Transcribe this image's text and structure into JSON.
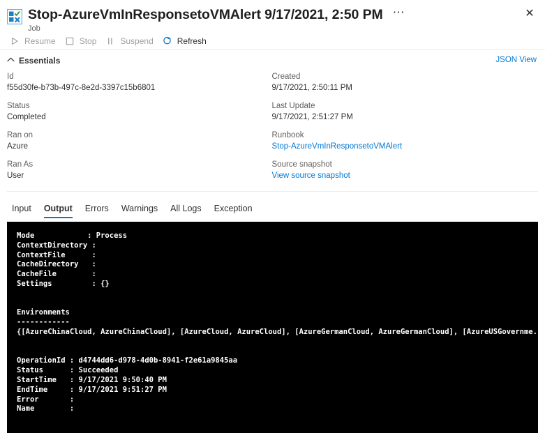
{
  "header": {
    "icon": "automation-job-icon",
    "title": "Stop-AzureVmInResponsetoVMAlert 9/17/2021, 2:50 PM",
    "subtitle": "Job",
    "more_label": "⋯",
    "close_label": "✕"
  },
  "commandbar": {
    "items": [
      {
        "label": "Resume",
        "icon": "play-icon",
        "enabled": false
      },
      {
        "label": "Stop",
        "icon": "stop-square-icon",
        "enabled": false
      },
      {
        "label": "Suspend",
        "icon": "pause-icon",
        "enabled": false
      },
      {
        "label": "Refresh",
        "icon": "refresh-icon",
        "enabled": true
      }
    ]
  },
  "essentials": {
    "heading": "Essentials",
    "collapse_icon": "chevron-up-icon",
    "json_view_label": "JSON View",
    "left": [
      {
        "label": "Id",
        "value": "f55d30fe-b73b-497c-8e2d-3397c15b6801",
        "link": false
      },
      {
        "label": "Status",
        "value": "Completed",
        "link": false
      },
      {
        "label": "Ran on",
        "value": "Azure",
        "link": false
      },
      {
        "label": "Ran As",
        "value": "User",
        "link": false
      }
    ],
    "right": [
      {
        "label": "Created",
        "value": "9/17/2021, 2:50:11 PM",
        "link": false
      },
      {
        "label": "Last Update",
        "value": "9/17/2021, 2:51:27 PM",
        "link": false
      },
      {
        "label": "Runbook",
        "value": "Stop-AzureVmInResponsetoVMAlert",
        "link": true
      },
      {
        "label": "Source snapshot",
        "value": "View source snapshot",
        "link": true
      }
    ]
  },
  "tabs": {
    "items": [
      {
        "label": "Input",
        "active": false
      },
      {
        "label": "Output",
        "active": true
      },
      {
        "label": "Errors",
        "active": false
      },
      {
        "label": "Warnings",
        "active": false
      },
      {
        "label": "All Logs",
        "active": false
      },
      {
        "label": "Exception",
        "active": false
      }
    ]
  },
  "console": {
    "text": "Mode            : Process\nContextDirectory :\nContextFile      :\nCacheDirectory   :\nCacheFile        :\nSettings         : {}\n\n\nEnvironments\n------------\n{[AzureChinaCloud, AzureChinaCloud], [AzureCloud, AzureCloud], [AzureGermanCloud, AzureGermanCloud], [AzureUSGovernme...\n\n\nOperationId : d4744dd6-d978-4d0b-8941-f2e61a9845aa\nStatus      : Succeeded\nStartTime   : 9/17/2021 9:50:40 PM\nEndTime     : 9/17/2021 9:51:27 PM\nError       :\nName        :"
  },
  "colors": {
    "accent": "#0078d4",
    "link": "#0078d4",
    "console_bg": "#000000",
    "console_fg": "#ffffff",
    "label": "#605e5c",
    "disabled": "#a19f9d"
  }
}
